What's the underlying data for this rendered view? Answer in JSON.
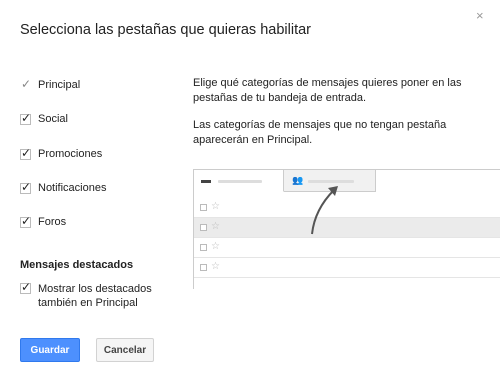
{
  "dialog": {
    "title": "Selecciona las pestañas que quieras habilitar",
    "close_icon": "close-icon",
    "close_glyph": "×"
  },
  "categories": [
    {
      "label": "Principal",
      "checked": true,
      "disabled": true
    },
    {
      "label": "Social",
      "checked": true,
      "disabled": false
    },
    {
      "label": "Promociones",
      "checked": true,
      "disabled": false
    },
    {
      "label": "Notificaciones",
      "checked": true,
      "disabled": false
    },
    {
      "label": "Foros",
      "checked": true,
      "disabled": false
    }
  ],
  "starred": {
    "section_title": "Mensajes destacados",
    "option_label": "Mostrar los destacados también en Principal",
    "checked": true
  },
  "description": {
    "paragraph1": "Elige qué categorías de mensajes quieres poner en las pestañas de tu bandeja de entrada.",
    "paragraph2": "Las categorías de mensajes que no tengan pestaña aparecerán en Principal."
  },
  "preview": {
    "tabs": [
      {
        "icon": "inbox-icon",
        "glyph": "▬",
        "active": true
      },
      {
        "icon": "people-icon",
        "glyph": "👥",
        "active": false
      }
    ],
    "rows": 4,
    "row_star_glyph": "☆"
  },
  "buttons": {
    "save_label": "Guardar",
    "cancel_label": "Cancelar"
  },
  "colors": {
    "primary_button": "#4d90fe",
    "arrow": "#555555"
  }
}
